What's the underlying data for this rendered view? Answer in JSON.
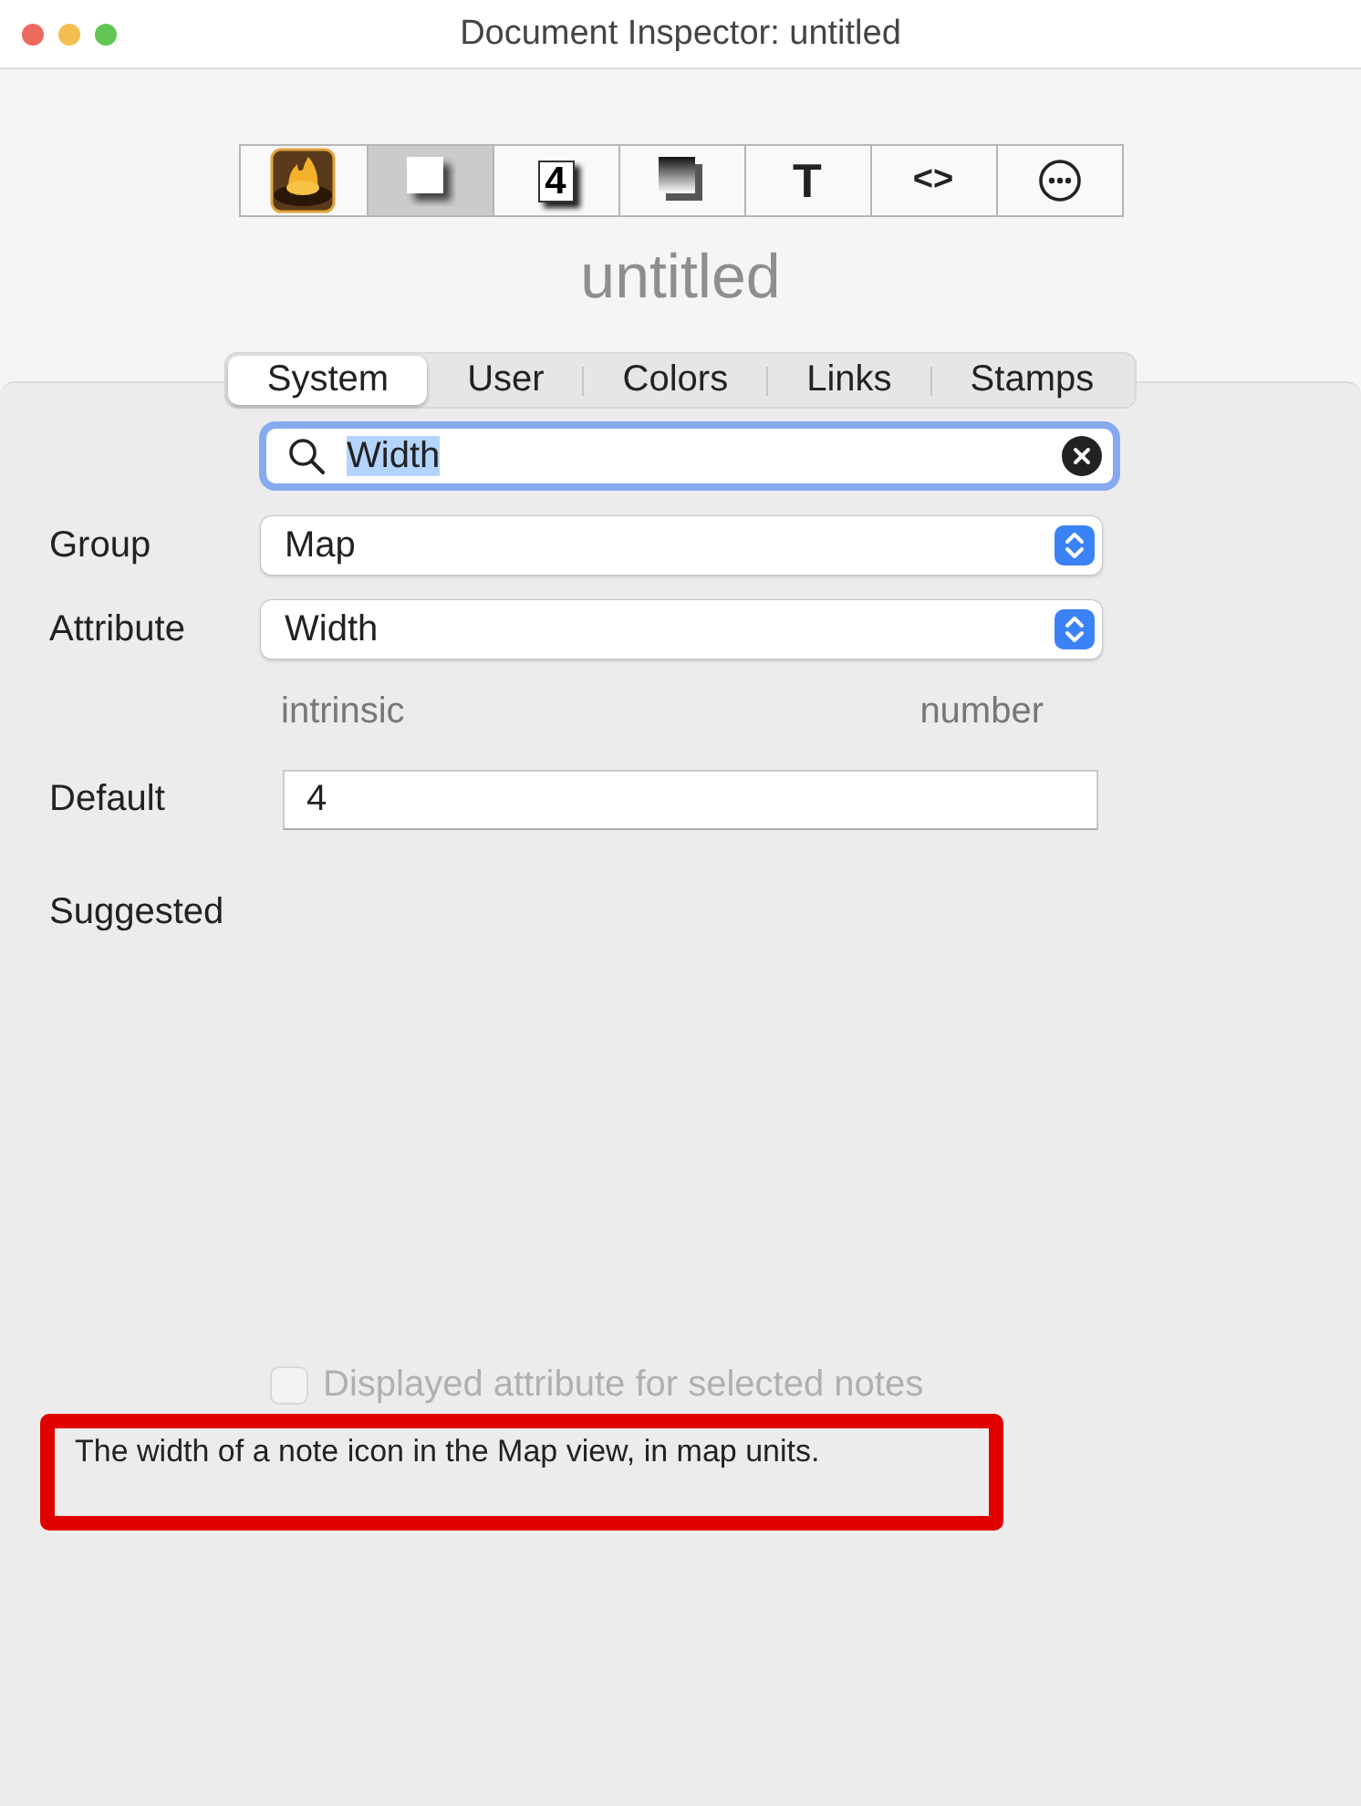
{
  "window": {
    "title": "Document Inspector: untitled"
  },
  "toolbar": [
    {
      "kind": "app",
      "selected": false
    },
    {
      "kind": "note",
      "selected": true
    },
    {
      "kind": "badge",
      "glyph": "4",
      "selected": false
    },
    {
      "kind": "shadow",
      "selected": false
    },
    {
      "kind": "glyph",
      "glyph": "T",
      "selected": false
    },
    {
      "kind": "glyph",
      "glyph": "<>",
      "selected": false
    },
    {
      "kind": "more",
      "selected": false
    }
  ],
  "document_name": "untitled",
  "tabs": [
    {
      "label": "System",
      "selected": true
    },
    {
      "label": "User",
      "selected": false
    },
    {
      "label": "Colors",
      "selected": false
    },
    {
      "label": "Links",
      "selected": false
    },
    {
      "label": "Stamps",
      "selected": false
    }
  ],
  "search": {
    "value": "Width",
    "text_selected": true
  },
  "group": {
    "label": "Group",
    "value": "Map"
  },
  "attribute": {
    "label": "Attribute",
    "value": "Width"
  },
  "attribute_info": {
    "origin": "intrinsic",
    "type": "number"
  },
  "default": {
    "label": "Default",
    "value": "4"
  },
  "suggested": {
    "label": "Suggested"
  },
  "displayed_checkbox": {
    "label": "Displayed attribute for selected notes",
    "checked": false,
    "disabled": true
  },
  "description": {
    "text": "The width of a note icon in the Map view, in map units.",
    "highlighted": true
  }
}
